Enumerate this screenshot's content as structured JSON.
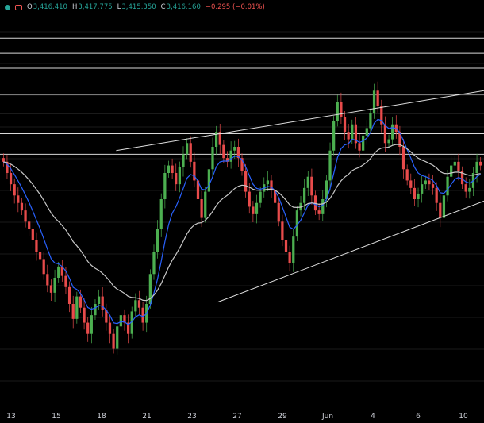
{
  "header": {
    "status_dot_color": "#26a69a",
    "indicator_icon": "eye-icon",
    "ohlc": [
      {
        "key": "O",
        "value": "3,416.410"
      },
      {
        "key": "H",
        "value": "3,417.775"
      },
      {
        "key": "L",
        "value": "3,415.350"
      },
      {
        "key": "C",
        "value": "3,416.160"
      }
    ],
    "change": "−0.295 (−0.01%)"
  },
  "chart_data": {
    "type": "candlestick",
    "x_tick_labels": [
      "13",
      "15",
      "18",
      "21",
      "23",
      "27",
      "29",
      "Jun",
      "4",
      "6",
      "10"
    ],
    "y_range_estimate": [
      3250,
      3460
    ],
    "horizontal_levels": [
      3448,
      3440,
      3432,
      3418,
      3408,
      3397,
      3386
    ],
    "trendlines": [
      {
        "name": "channel-upper",
        "from": [
          0.24,
          3388
        ],
        "to": [
          1.0,
          3420
        ]
      },
      {
        "name": "channel-lower",
        "from": [
          0.45,
          3307
        ],
        "to": [
          1.0,
          3361
        ]
      }
    ],
    "closes": [
      3382,
      3376,
      3370,
      3364,
      3360,
      3356,
      3350,
      3346,
      3340,
      3334,
      3330,
      3322,
      3316,
      3312,
      3320,
      3326,
      3321,
      3315,
      3306,
      3298,
      3310,
      3304,
      3296,
      3290,
      3300,
      3306,
      3310,
      3303,
      3296,
      3290,
      3282,
      3294,
      3300,
      3296,
      3290,
      3302,
      3308,
      3304,
      3296,
      3306,
      3322,
      3334,
      3346,
      3362,
      3376,
      3380,
      3376,
      3370,
      3379,
      3386,
      3392,
      3382,
      3372,
      3362,
      3352,
      3366,
      3378,
      3390,
      3398,
      3391,
      3384,
      3382,
      3388,
      3390,
      3384,
      3377,
      3366,
      3358,
      3354,
      3360,
      3366,
      3370,
      3372,
      3367,
      3360,
      3350,
      3340,
      3334,
      3328,
      3342,
      3356,
      3360,
      3368,
      3374,
      3364,
      3356,
      3354,
      3362,
      3372,
      3388,
      3404,
      3414,
      3406,
      3398,
      3394,
      3402,
      3392,
      3388,
      3396,
      3400,
      3408,
      3420,
      3412,
      3402,
      3392,
      3394,
      3402,
      3398,
      3390,
      3378,
      3372,
      3368,
      3362,
      3365,
      3370,
      3372,
      3370,
      3368,
      3360,
      3352,
      3364,
      3374,
      3380,
      3382,
      3377,
      3370,
      3366,
      3368,
      3376,
      3382,
      3380
    ],
    "ema_fast_color": "#2962ff",
    "ma_slow_color": "#c8c8c8"
  }
}
